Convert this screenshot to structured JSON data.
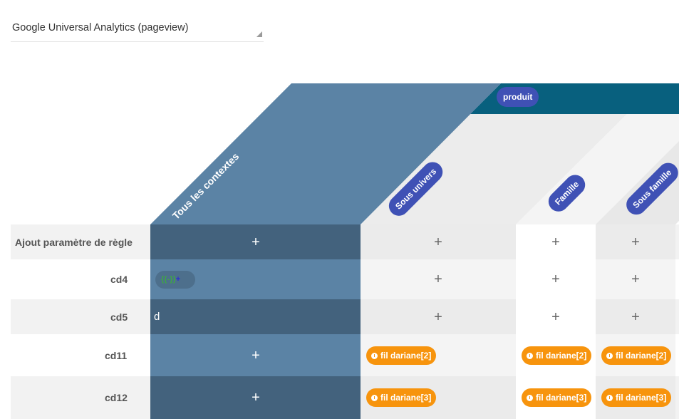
{
  "select": {
    "value": "Google Universal Analytics (pageview)"
  },
  "header": {
    "group_label": "produit",
    "context_column": "Tous les contextes",
    "columns": [
      "Sous univers",
      "Famille",
      "Sous famille"
    ]
  },
  "rows": [
    {
      "label": "Ajout paramètre de règle",
      "context": "+",
      "cells": [
        "+",
        "+",
        "+"
      ]
    },
    {
      "label": "cd4",
      "context_chip": {
        "left": "{{",
        "mid": "-",
        "right": "}}",
        "plus": "+"
      },
      "cells": [
        "+",
        "+",
        "+"
      ]
    },
    {
      "label": "cd5",
      "context": "d",
      "cells": [
        "+",
        "+",
        "+"
      ]
    },
    {
      "label": "cd11",
      "context": "+",
      "cells": [
        "fil dariane[2]",
        "fil dariane[2]",
        "fil dariane[2]"
      ]
    },
    {
      "label": "cd12",
      "context": "+",
      "cells": [
        "fil dariane[3]",
        "fil dariane[3]",
        "fil dariane[3]"
      ]
    }
  ],
  "colors": {
    "context_light": "#5b83a5",
    "context_dark": "#43627d",
    "group_band": "#08607e",
    "pill": "#3f51b5",
    "tag_orange": "#f7940d"
  }
}
